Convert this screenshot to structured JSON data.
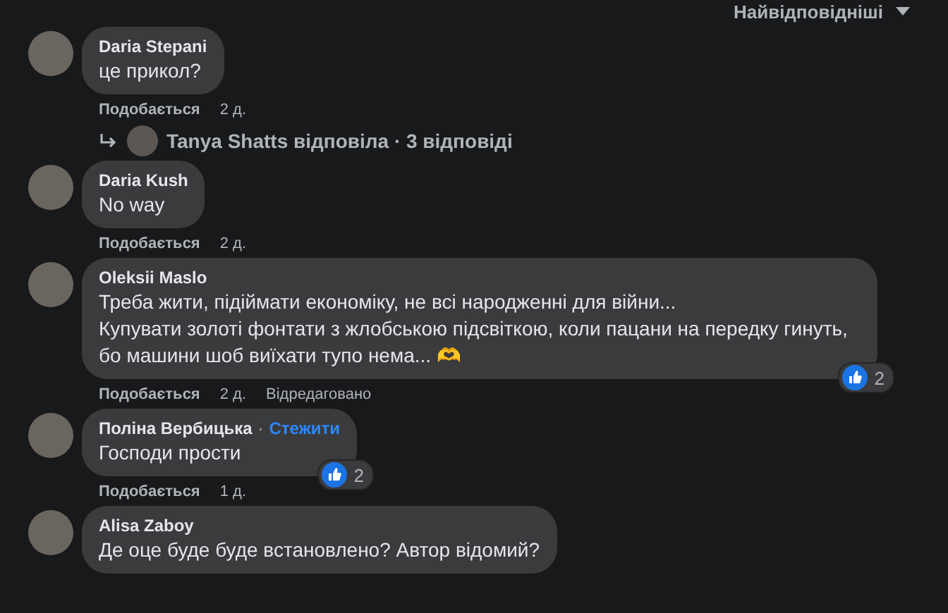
{
  "sort": {
    "label": "Найвідповідніші"
  },
  "comments": [
    {
      "author": "Daria Stepani",
      "text": "це прикол?",
      "like_label": "Подобається",
      "time": "2 д.",
      "replies": {
        "text": "Tanya Shatts відповіла · 3 відповіді"
      }
    },
    {
      "author": "Daria Kush",
      "text": "No way",
      "like_label": "Подобається",
      "time": "2 д."
    },
    {
      "author": "Oleksii Maslo",
      "text": "Треба жити, підіймати економіку, не всі народженні для війни...\nКупувати золоті фонтати з жлобською підсвіткою, коли пацани на передку гинуть, бо машини шоб виїхати тупо нема... 🫶",
      "like_label": "Подобається",
      "time": "2 д.",
      "edited": "Відредаговано",
      "reactions": "2"
    },
    {
      "author": "Поліна Вербицька",
      "separator": "·",
      "follow": "Стежити",
      "text": "Господи прости",
      "like_label": "Подобається",
      "time": "1 д.",
      "reactions": "2"
    },
    {
      "author": "Alisa Zaboy",
      "text": "Де оце буде буде встановлено? Автор відомий?"
    }
  ]
}
